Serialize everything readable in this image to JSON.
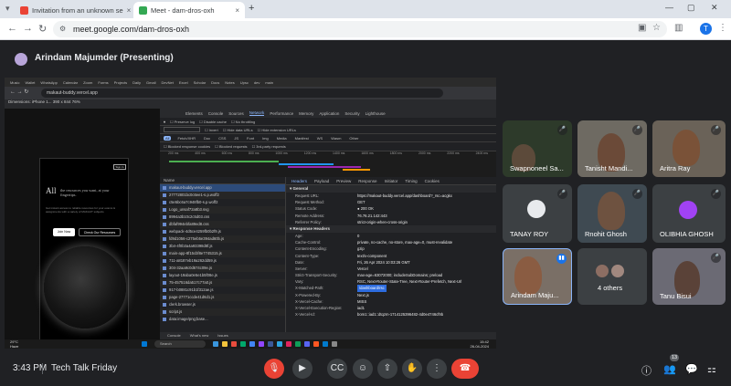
{
  "browser": {
    "tabs": [
      {
        "label": "Invitation from an unknown se",
        "favicon_color": "#ea4335"
      },
      {
        "label": "Meet - dam-dros-oxh",
        "favicon_color": "#34a853"
      }
    ],
    "new_tab_icon": "plus-icon",
    "url": "meet.google.com/dam-dros-oxh",
    "profile_initial": "T"
  },
  "presenter": {
    "label": "Arindam Majumder (Presenting)"
  },
  "shared_screen": {
    "bookmarks": [
      "Music",
      "Wallet",
      "WhatsApp",
      "Calendar",
      "Zoom",
      "Forms",
      "Projects",
      "Daily",
      "Gmail",
      "DevNet",
      "Excel",
      "Scholar",
      "Docs",
      "Notes",
      "Upsc",
      "dev",
      "main"
    ],
    "inner_url": "makaut-buddy.vercel.app",
    "device_row": "Dimensions: iPhone 1...   390   x   844   76%",
    "phone": {
      "headline_part1": "All",
      "headline_part2": "the resources you want, at your fingertips.",
      "subtext": "Get instant access to reliable resources for your exams & assignments with a variety of MAKAUT subjects",
      "join_label": "Join Now",
      "check_label": "Check Our Resources",
      "signin": "Sign In"
    },
    "devtools_tabs": [
      "Elements",
      "Console",
      "Sources",
      "Network",
      "Performance",
      "Memory",
      "Application",
      "Security",
      "Lighthouse"
    ],
    "devtools_active_tab": "Network",
    "network_options": [
      "Preserve log",
      "Disable cache",
      "No throttling"
    ],
    "filter_row": [
      "Invert",
      "Hide data URLs",
      "Hide extension URLs"
    ],
    "type_chips": [
      "All",
      "Fetch/XHR",
      "Doc",
      "CSS",
      "JS",
      "Font",
      "Img",
      "Media",
      "Manifest",
      "WS",
      "Wasm",
      "Other"
    ],
    "blocked_opts": [
      "Blocked response cookies",
      "Blocked requests",
      "3rd-party requests"
    ],
    "timeline_ticks": [
      "200 ms",
      "400 ms",
      "600 ms",
      "800 ms",
      "1000 ms",
      "1200 ms",
      "1400 ms",
      "1600 ms",
      "1800 ms",
      "2000 ms",
      "2200 ms",
      "2400 ms"
    ],
    "files_header": "Name",
    "files": [
      "makaut-buddy.vercel.app",
      "27772801bc0c6ee1-s.p.woff2",
      "c5e5bc6a7c948fb0-s.p.woff2",
      "Logo_unsaf72a8b3.svg",
      "8994a3b10c2c5d03.css",
      "dbfaf994ebfa89ed8.css",
      "webpack-4d5ce4259fb0b2f9.js",
      "fd9d1056-c275eb5e394ad60b.js",
      "3b4-4f0b3a4a93398d8f.js",
      "main-app-8f15cbf8e7745315.js",
      "711-a8187eb19a262dd59.js",
      "304-32aa9c0d674c09e.js",
      "layout-19aba0e5e1b5f08e.js",
      "75-457516da517c77a0.js",
      "917-b0881c91b1f312ae.js",
      "page-27771ccde41d6d1.js",
      "clerk.browser.js",
      "script.js",
      "data:image/png;base..."
    ],
    "header_tabs": [
      "Headers",
      "Payload",
      "Preview",
      "Response",
      "Initiator",
      "Timing",
      "Cookies"
    ],
    "general_title": "General",
    "general": [
      {
        "k": "Request URL:",
        "v": "https://makaut-buddy.vercel.app/dashboard?_rsc=acgkx"
      },
      {
        "k": "Request Method:",
        "v": "GET"
      },
      {
        "k": "Status Code:",
        "v": "● 200 OK"
      },
      {
        "k": "Remote Address:",
        "v": "76.76.21.142:443"
      },
      {
        "k": "Referrer Policy:",
        "v": "strict-origin-when-cross-origin"
      }
    ],
    "response_title": "Response Headers",
    "response": [
      {
        "k": "Age:",
        "v": "0"
      },
      {
        "k": "Cache-Control:",
        "v": "private, no-cache, no-store, max-age=0, must-revalidate"
      },
      {
        "k": "Content-Encoding:",
        "v": "gzip"
      },
      {
        "k": "Content-Type:",
        "v": "text/x-component"
      },
      {
        "k": "Date:",
        "v": "Fri, 26 Apr 2024 10:03:26 GMT"
      },
      {
        "k": "Server:",
        "v": "Vercel"
      },
      {
        "k": "Strict-Transport-Security:",
        "v": "max-age=63072000; includeSubDomains; preload"
      },
      {
        "k": "Vary:",
        "v": "RSC, Next-Router-State-Tree, Next-Router-Prefetch, Next-Url"
      },
      {
        "k": "X-Matched-Path:",
        "v": "/dashboard/rsc"
      },
      {
        "k": "X-Powered-By:",
        "v": "Next.js"
      },
      {
        "k": "X-Vercel-Cache:",
        "v": "MISS"
      },
      {
        "k": "X-Vercel-Execution-Region:",
        "v": "iad1"
      },
      {
        "k": "X-Vercel-Id:",
        "v": "bom1::iad1::dtqzm-1714125396482-4d0e4746cf9b"
      }
    ],
    "status_items": [
      "27 requests",
      "13.1 kB transferred",
      "1.2 MB resources",
      "Finish: 2.02 s"
    ],
    "console_tabs": [
      "Console",
      "What's new",
      "Issues"
    ],
    "taskbar_search": "Search",
    "weather_temp": "29°C",
    "weather_desc": "Haze",
    "clock_time": "15:42",
    "clock_date": "26-04-2024"
  },
  "participants": [
    {
      "name": "Swapnoneel Sa...",
      "muted": true
    },
    {
      "name": "Tanisht Mandi...",
      "muted": true
    },
    {
      "name": "Aritra Ray",
      "muted": true
    },
    {
      "name": "TANAY ROY",
      "muted": true
    },
    {
      "name": "Rnohit Ghosh",
      "muted": true
    },
    {
      "name": "OLIBHIA GHOSH",
      "muted": true
    },
    {
      "name": "Arindam Maju...",
      "muted": false
    },
    {
      "name": "4 others",
      "muted": false
    },
    {
      "name": "Tanu Bisui",
      "muted": true
    }
  ],
  "meeting": {
    "time": "3:43 PM",
    "name": "Tech Talk Friday",
    "people_count": "13"
  },
  "colors": {
    "accent_blue": "#8ab4f8",
    "hangup_red": "#ea4335",
    "mic_off_red": "#ea4335",
    "bar_bg": "#202124"
  },
  "icons": [
    "mic-off-icon",
    "camera-icon",
    "captions-icon",
    "emoji-icon",
    "present-icon",
    "raise-hand-icon",
    "more-icon",
    "hangup-icon",
    "info-icon",
    "people-icon",
    "chat-icon",
    "activities-icon"
  ]
}
